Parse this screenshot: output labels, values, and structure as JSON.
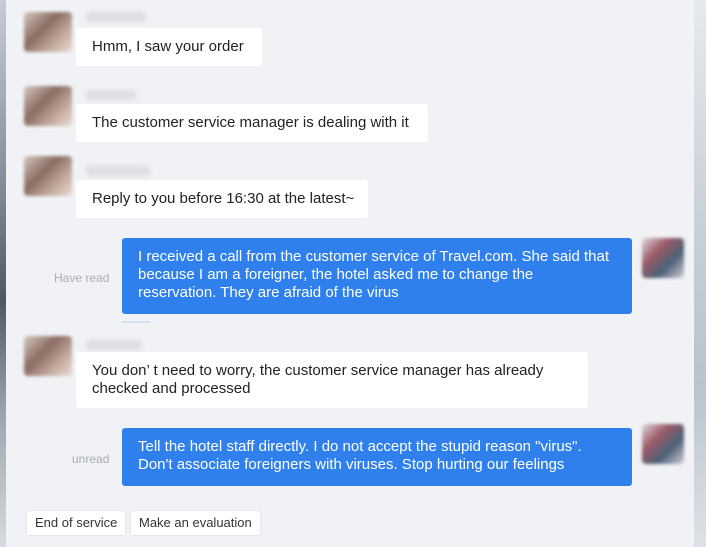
{
  "messages": [
    {
      "sender": "agent",
      "lines": [
        "Hmm, I saw your order"
      ]
    },
    {
      "sender": "agent",
      "lines": [
        "The customer service manager is dealing with it"
      ]
    },
    {
      "sender": "agent",
      "lines": [
        "Reply to you before 16:30 at the latest~"
      ]
    },
    {
      "sender": "user",
      "status": "Have read",
      "lines": [
        "I received a call from the customer service of Travel.com. She said that",
        "because I am a foreigner, the hotel asked me to change the",
        "reservation. They are afraid of the virus"
      ]
    },
    {
      "sender": "agent",
      "lines": [
        "You don’  t need to worry, the customer service manager has already",
        "checked and processed"
      ]
    },
    {
      "sender": "user",
      "status": "unread",
      "lines": [
        "Tell the hotel staff directly. I do not accept the stupid reason \"virus\".",
        "Don't associate foreigners with viruses. Stop hurting our feelings"
      ]
    }
  ],
  "actions": {
    "end_service": "End of service",
    "evaluate": "Make an evaluation"
  },
  "colors": {
    "outgoing_bubble": "#2f80ed",
    "incoming_bubble": "#ffffff",
    "background": "#f0f2f5"
  }
}
